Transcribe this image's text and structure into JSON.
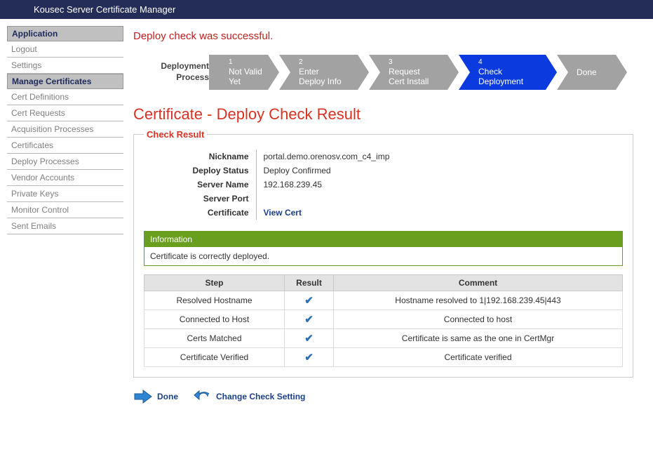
{
  "app_title": "Kousec Server Certificate Manager",
  "sidebar": {
    "sections": [
      {
        "label": "Application",
        "items": [
          "Logout",
          "Settings"
        ]
      },
      {
        "label": "Manage Certificates",
        "items": [
          "Cert Definitions",
          "Cert Requests",
          "Acquisition Processes",
          "Certificates",
          "Deploy Processes",
          "Vendor Accounts",
          "Private Keys",
          "Monitor Control",
          "Sent Emails"
        ]
      }
    ]
  },
  "success_message": "Deploy check was successful.",
  "process": {
    "label_line1": "Deployment",
    "label_line2": "Process",
    "steps": [
      {
        "num": "1",
        "line1": "Not Valid",
        "line2": "Yet",
        "active": false
      },
      {
        "num": "2",
        "line1": "Enter",
        "line2": "Deploy Info",
        "active": false
      },
      {
        "num": "3",
        "line1": "Request",
        "line2": "Cert Install",
        "active": false
      },
      {
        "num": "4",
        "line1": "Check",
        "line2": "Deployment",
        "active": true
      },
      {
        "num": "",
        "line1": "Done",
        "line2": "",
        "active": false
      }
    ]
  },
  "page_title": "Certificate - Deploy Check Result",
  "result": {
    "legend": "Check Result",
    "rows": {
      "nickname_label": "Nickname",
      "nickname_value": "portal.demo.orenosv.com_c4_imp",
      "deploy_status_label": "Deploy Status",
      "deploy_status_value": "Deploy Confirmed",
      "server_name_label": "Server Name",
      "server_name_value": "192.168.239.45",
      "server_port_label": "Server Port",
      "server_port_value": "",
      "certificate_label": "Certificate",
      "certificate_link": "View Cert"
    },
    "info": {
      "header": "Information",
      "body": "Certificate is correctly deployed."
    },
    "steps_table": {
      "headers": {
        "step": "Step",
        "result": "Result",
        "comment": "Comment"
      },
      "rows": [
        {
          "step": "Resolved Hostname",
          "ok": true,
          "comment": "Hostname resolved to 1|192.168.239.45|443"
        },
        {
          "step": "Connected to Host",
          "ok": true,
          "comment": "Connected to host"
        },
        {
          "step": "Certs Matched",
          "ok": true,
          "comment": "Certificate is same as the one in CertMgr"
        },
        {
          "step": "Certificate Verified",
          "ok": true,
          "comment": "Certificate verified"
        }
      ]
    }
  },
  "actions": {
    "done": "Done",
    "change": "Change Check Setting"
  }
}
